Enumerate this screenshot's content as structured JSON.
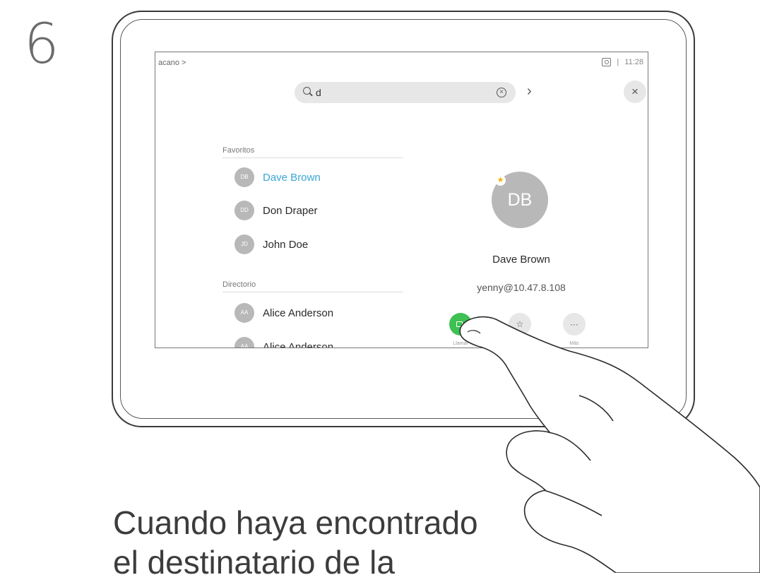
{
  "step_number": "6",
  "screen": {
    "breadcrumb": "acano >",
    "time": "11:28",
    "search": {
      "value": "d"
    },
    "sections": {
      "favorites_label": "Favoritos",
      "directory_label": "Directorio"
    },
    "favorites": [
      {
        "initials": "DB",
        "name": "Dave Brown",
        "highlighted": true
      },
      {
        "initials": "DD",
        "name": "Don Draper",
        "highlighted": false
      },
      {
        "initials": "JD",
        "name": "John Doe",
        "highlighted": false
      }
    ],
    "directory": [
      {
        "initials": "AA",
        "name": "Alice Anderson"
      },
      {
        "initials": "AA",
        "name": "Alice Anderson"
      }
    ],
    "contact": {
      "initials": "DB",
      "name": "Dave Brown",
      "address": "yenny@10.47.8.108",
      "favorite_icon": "star-icon"
    },
    "actions": {
      "call_label": "Llamar",
      "more_label": "Más",
      "more_glyph": "···",
      "favorite_icon": "star-icon",
      "call_icon": "camera-icon"
    },
    "colors": {
      "call": "#3ec053",
      "highlight": "#3aa7d4",
      "avatar": "#b8b8b8"
    }
  },
  "caption_line1": "Cuando haya encontrado",
  "caption_line2": "el destinatario de la"
}
